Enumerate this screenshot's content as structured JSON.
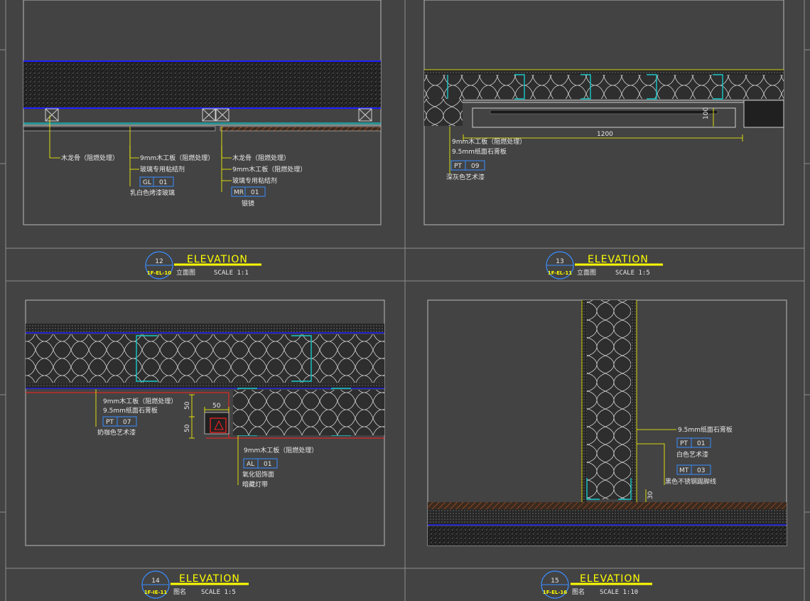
{
  "colors": {
    "background": "#434343",
    "frame": "#b9b9b9",
    "leader": "#ffff00",
    "hatch_blue": "#1e1eff",
    "cyan": "#18c8c8",
    "tag_blue": "#3a8cff",
    "red": "#ff2020",
    "text": "#e8e8e8"
  },
  "panels": [
    {
      "id": "p12",
      "callout": {
        "number": "12",
        "code": "1F-EL-10"
      },
      "heading": "ELEVATION",
      "subtitle": "立面图",
      "scale": "SCALE 1:1",
      "notes": {
        "left_a": "木龙骨（阻燃处理）",
        "mid_a": "9mm木工板（阻燃处理）",
        "mid_b": "玻璃专用粘结剂",
        "mid_tag_code": "GL",
        "mid_tag_num": "01",
        "mid_c": "乳白色烤漆玻璃",
        "right_a": "木龙骨（阻燃处理）",
        "right_b": "9mm木工板（阻燃处理）",
        "right_c": "玻璃专用粘结剂",
        "right_tag_code": "MR",
        "right_tag_num": "01",
        "right_d": "银镜"
      }
    },
    {
      "id": "p13",
      "callout": {
        "number": "13",
        "code": "1F-EL-11"
      },
      "heading": "ELEVATION",
      "subtitle": "立面图",
      "scale": "SCALE 1:5",
      "notes": {
        "a": "9mm木工板（阻燃处理）",
        "b": "9.5mm纸面石膏板",
        "tag_code": "PT",
        "tag_num": "09",
        "c": "深灰色艺术漆",
        "dim_width": "1200",
        "dim_height": "100"
      }
    },
    {
      "id": "p14",
      "callout": {
        "number": "14",
        "code": "1F-IE-11"
      },
      "heading": "ELEVATION",
      "subtitle": "图名",
      "scale": "SCALE 1:5",
      "notes": {
        "a": "9mm木工板（阻燃处理）",
        "b": "9.5mm纸面石膏板",
        "tag1_code": "PT",
        "tag1_num": "07",
        "c": "奶咖色艺术漆",
        "dim_w": "50",
        "dim_h1": "50",
        "dim_h2": "50",
        "d": "9mm木工板（阻燃处理）",
        "tag2_code": "AL",
        "tag2_num": "01",
        "e": "氧化铝饰面",
        "f": "暗藏灯带"
      }
    },
    {
      "id": "p15",
      "callout": {
        "number": "15",
        "code": "1F-EL-16"
      },
      "heading": "ELEVATION",
      "subtitle": "图名",
      "scale": "SCALE 1:10",
      "notes": {
        "a": "9.5mm纸面石膏板",
        "tag1_code": "PT",
        "tag1_num": "01",
        "b": "白色艺术漆",
        "tag2_code": "MT",
        "tag2_num": "03",
        "c": "黑色不锈钢踢脚线",
        "dim": "30"
      }
    }
  ]
}
